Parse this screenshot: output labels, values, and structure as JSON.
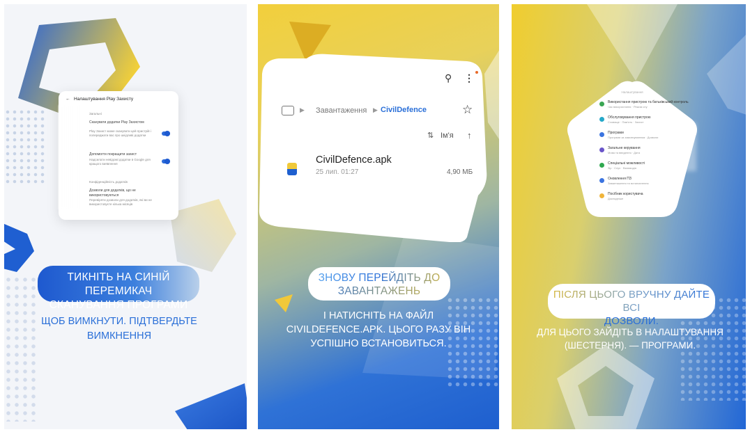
{
  "panel1": {
    "settings_title": "Налаштування Play Захисту",
    "section_general": "Загальні",
    "scan_title": "Сканувати додатки Play Захистом",
    "scan_desc": "Play Захист може сканувати цей пристрій і попереджати вас про шкідливі додатки",
    "improve_title": "Допомогти покращити захист",
    "improve_desc": "Надсилати невідомі додатки в Google для кращого виявлення",
    "section_privacy": "Конфіденційність додатків",
    "remove_title": "Дозволи для додатків, що не використовуються",
    "remove_desc": "Перевіряти дозволи для додатків, які ви не використовуєте кілька місяців",
    "caption_line1": "ТИКНІТЬ НА СИНІЙ ПЕРЕМИКАЧ",
    "caption_line2": "СКАНУВАННЯ ПРОГРАМИ",
    "sub_line1": "ЩОБ ВИМКНУТИ. ПІДТВЕРДЬТЕ",
    "sub_line2": "ВИМКНЕННЯ"
  },
  "panel2": {
    "breadcrumb_folder": "Завантаження",
    "breadcrumb_current": "CivilDefence",
    "sort_label": "Ім'я",
    "file_name": "CivilDefence.apk",
    "file_date": "25 лип. 01:27",
    "file_size": "4,90 МБ",
    "caption_line1": "ЗНОВУ ПЕРЕЙДІТЬ ДО",
    "caption_line2": "ЗАВАНТАЖЕНЬ",
    "sub_line1": "І НАТИСНІТЬ НА ФАЙЛ",
    "sub_line2": "CIVILDEFENCE.APK. ЦЬОГО РАЗУ ВІН",
    "sub_line3": "УСПІШНО ВСТАНОВИТЬСЯ."
  },
  "panel3": {
    "menu_header": "Налаштування",
    "menu_items": [
      {
        "title": "Використання пристрою та батьківський контроль",
        "sub": "Час використання · Режим сну",
        "color": "#3aa653"
      },
      {
        "title": "Обслуговування пристрою",
        "sub": "Сховище · Пам'ять · Захист",
        "color": "#25a8c9"
      },
      {
        "title": "Програми",
        "sub": "Програми за замовчуванням · Дозволи",
        "color": "#3b74e0"
      },
      {
        "title": "Загальне керування",
        "sub": "Мова та введення · Дата",
        "color": "#6a55c9"
      },
      {
        "title": "Спеціальні можливості",
        "sub": "Зір · Слух · Взаємодія",
        "color": "#2fa84f"
      },
      {
        "title": "Оновлення ПЗ",
        "sub": "Завантаження та встановлення",
        "color": "#3b74e0"
      },
      {
        "title": "Посібник користувача",
        "sub": "Докладніше",
        "color": "#f0b43a"
      }
    ],
    "caption_line1": "ПІСЛЯ ЦЬОГО ВРУЧНУ ДАЙТЕ ВСІ",
    "caption_line2": "ДОЗВОЛИ.",
    "sub_line1": "ДЛЯ ЦЬОГО ЗАЙДІТЬ В НАЛАШТУВАННЯ",
    "sub_line2": "(ШЕСТЕРНЯ). — ПРОГРАМИ."
  },
  "colors": {
    "ukraine_blue": "#1e5fcf",
    "ukraine_yellow": "#f2cf3c",
    "caption_blue": "#2a6fd8"
  }
}
